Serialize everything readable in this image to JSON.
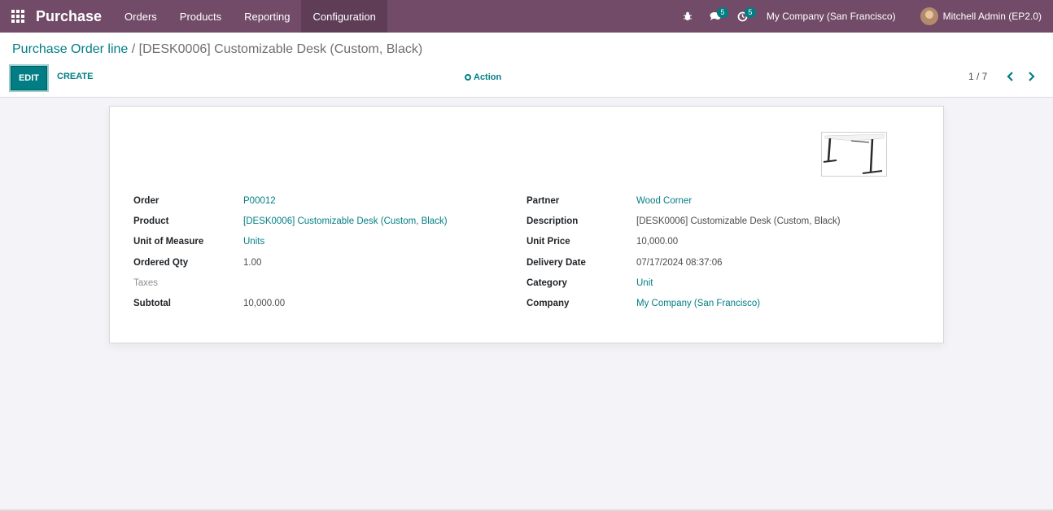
{
  "navbar": {
    "app_name": "Purchase",
    "menu": [
      "Orders",
      "Products",
      "Reporting",
      "Configuration"
    ],
    "messages_count": "5",
    "activities_count": "5",
    "company": "My Company (San Francisco)",
    "user": "Mitchell Admin (EP2.0)",
    "accent": "#714b67"
  },
  "breadcrumb": {
    "parent": "Purchase Order line",
    "separator": " / ",
    "current": "[DESK0006] Customizable Desk (Custom, Black)"
  },
  "toolbar": {
    "edit_label": "EDIT",
    "create_label": "CREATE",
    "action_label": "Action"
  },
  "pager": {
    "value": "1 / 7"
  },
  "form": {
    "left": [
      {
        "label": "Order",
        "value": "P00012",
        "link": true
      },
      {
        "label": "Product",
        "value": "[DESK0006] Customizable Desk (Custom, Black)",
        "link": true
      },
      {
        "label": "Unit of Measure",
        "value": "Units",
        "link": true
      },
      {
        "label": "Ordered Qty",
        "value": "1.00",
        "link": false
      },
      {
        "label": "Taxes",
        "value": "",
        "link": false
      },
      {
        "label": "Subtotal",
        "value": "10,000.00",
        "link": false
      }
    ],
    "right": [
      {
        "label": "Partner",
        "value": "Wood Corner",
        "link": true
      },
      {
        "label": "Description",
        "value": "[DESK0006] Customizable Desk (Custom, Black)",
        "link": false
      },
      {
        "label": "Unit Price",
        "value": "10,000.00",
        "link": false
      },
      {
        "label": "Delivery Date",
        "value": "07/17/2024 08:37:06",
        "link": false
      },
      {
        "label": "Category",
        "value": "Unit",
        "link": true
      },
      {
        "label": "Company",
        "value": "My Company (San Francisco)",
        "link": true
      }
    ]
  }
}
